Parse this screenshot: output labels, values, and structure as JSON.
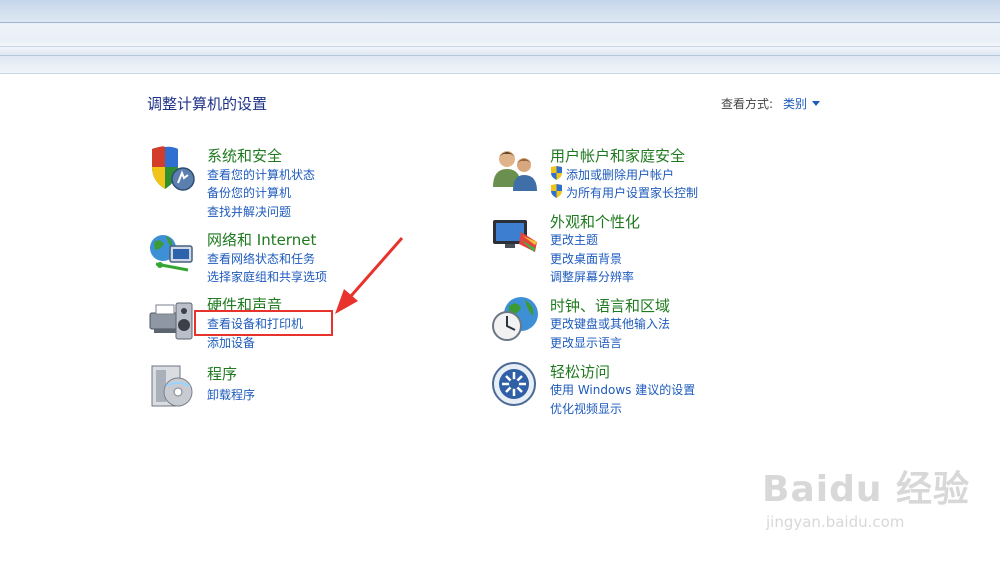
{
  "page": {
    "title": "调整计算机的设置",
    "view_label": "查看方式:",
    "view_value": "类别"
  },
  "categories": [
    {
      "title": "系统和安全",
      "icon": "shield-computer-icon",
      "links": [
        "查看您的计算机状态",
        "备份您的计算机",
        "查找并解决问题"
      ]
    },
    {
      "title": "网络和 Internet",
      "icon": "network-globe-icon",
      "links": [
        "查看网络状态和任务",
        "选择家庭组和共享选项"
      ]
    },
    {
      "title": "硬件和声音",
      "icon": "printer-speaker-icon",
      "links": [
        "查看设备和打印机",
        "添加设备"
      ]
    },
    {
      "title": "程序",
      "icon": "programs-disc-icon",
      "links": [
        "卸载程序"
      ]
    },
    {
      "title": "用户帐户和家庭安全",
      "icon": "users-icon",
      "links": [
        "添加或删除用户帐户",
        "为所有用户设置家长控制"
      ]
    },
    {
      "title": "外观和个性化",
      "icon": "monitor-paint-icon",
      "links": [
        "更改主题",
        "更改桌面背景",
        "调整屏幕分辨率"
      ]
    },
    {
      "title": "时钟、语言和区域",
      "icon": "clock-globe-icon",
      "links": [
        "更改键盘或其他输入法",
        "更改显示语言"
      ]
    },
    {
      "title": "轻松访问",
      "icon": "ease-of-access-icon",
      "links": [
        "使用 Windows 建议的设置",
        "优化视频显示"
      ]
    }
  ],
  "watermark": {
    "logo": "Baidu 经验",
    "url": "jingyan.baidu.com"
  },
  "colors": {
    "category_title": "#1f7a1f",
    "link": "#1e5bbd",
    "page_title": "#1e3287",
    "annotation": "#e8332d"
  }
}
